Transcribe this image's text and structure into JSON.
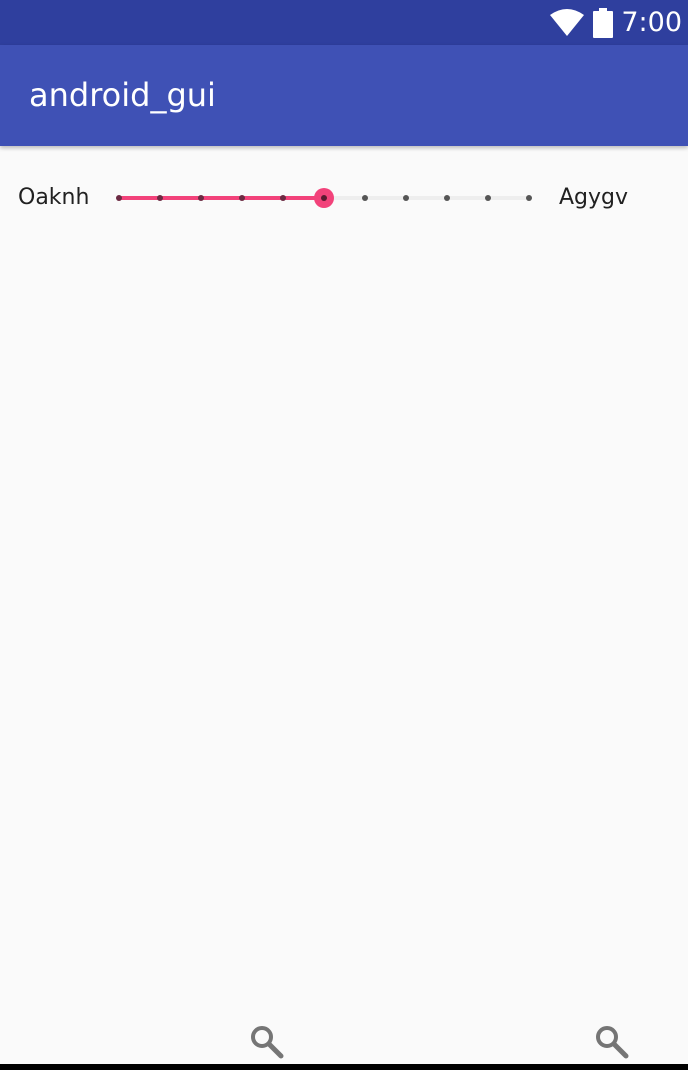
{
  "status_bar": {
    "time": "7:00",
    "icons": [
      "wifi-icon",
      "battery-icon"
    ],
    "background": "#2f3f9e"
  },
  "app_bar": {
    "title": "android_gui",
    "background": "#3f51b5"
  },
  "slider": {
    "left_label": "Oaknh",
    "right_label": "Agygv",
    "min": 0,
    "max": 10,
    "steps": 10,
    "value": 5,
    "accent": "#f2427a",
    "track_color": "#eeeeee",
    "tick_color": "#555555"
  },
  "nav_bar": {
    "icons": [
      "search-icon",
      "search-icon"
    ]
  }
}
